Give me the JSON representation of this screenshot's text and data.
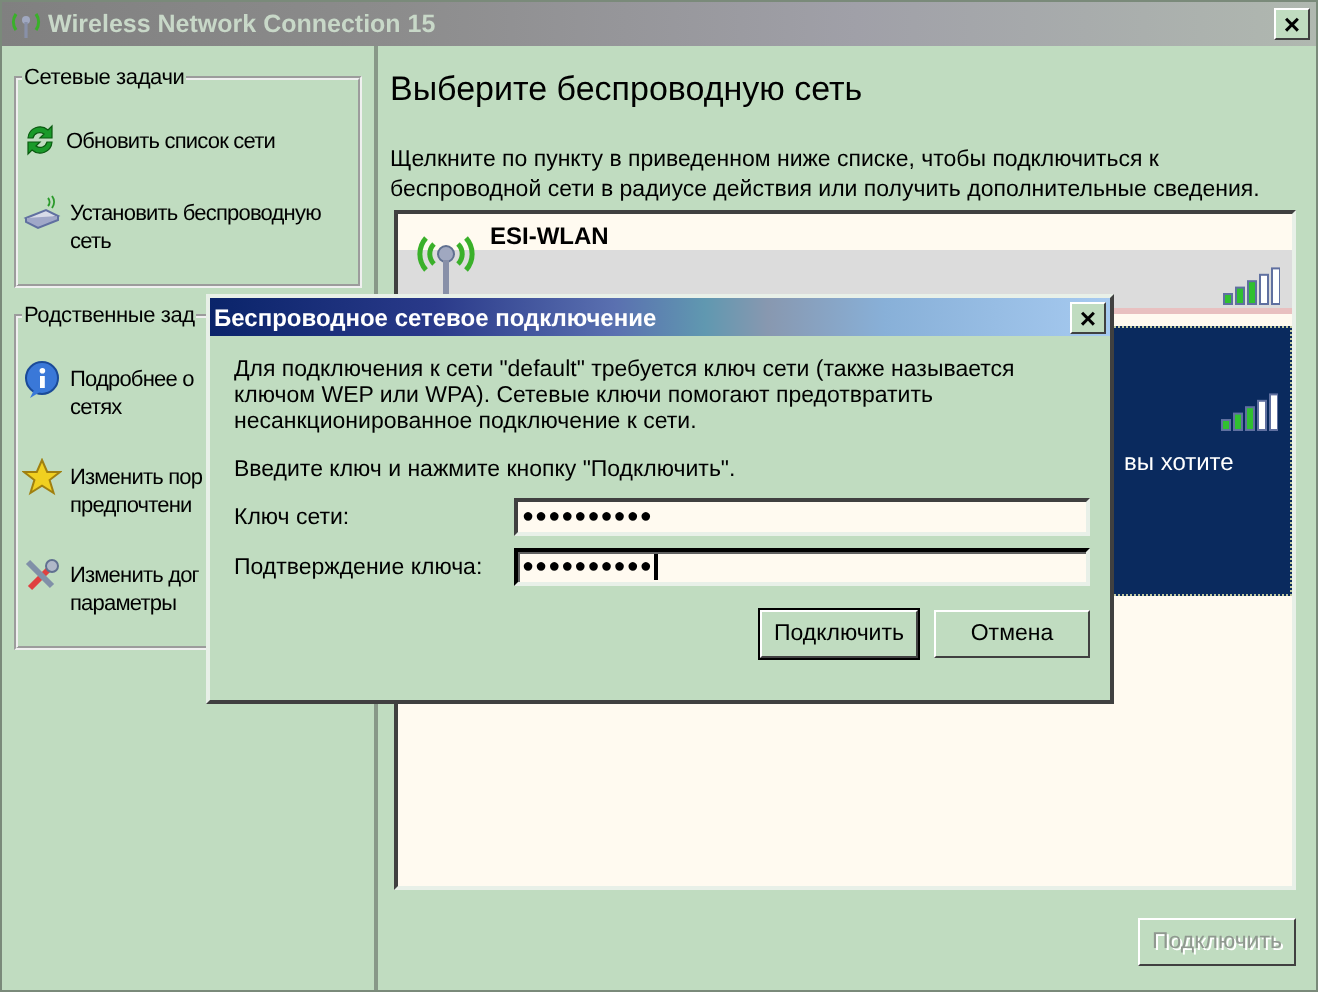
{
  "window": {
    "title": "Wireless Network Connection 15",
    "close": "×"
  },
  "sidebar": {
    "groups": [
      {
        "title": "Сетевые задачи",
        "items": [
          {
            "kind": "refresh",
            "lines": [
              "Обновить список сети"
            ]
          },
          {
            "kind": "setup",
            "lines": [
              "Установить беспроводную",
              "сеть"
            ]
          }
        ]
      },
      {
        "title": "Родственные зад",
        "items": [
          {
            "kind": "info",
            "lines": [
              "Подробнее о",
              "сетях"
            ]
          },
          {
            "kind": "star",
            "lines": [
              "Изменить пор",
              "предпочтени"
            ]
          },
          {
            "kind": "tools",
            "lines": [
              "Изменить дог",
              "параметры"
            ]
          }
        ]
      }
    ]
  },
  "main": {
    "heading": "Выберите беспроводную сеть",
    "description": "Щелкните по пункту в приведенном ниже списке, чтобы подключиться к\nбеспроводной сети в радиусе действия или получить дополнительные сведения.",
    "networks": [
      {
        "name": "ESI-WLAN",
        "selected": false
      },
      {
        "note": "вы хотите",
        "selected": true
      }
    ],
    "connect_button": {
      "label": "Подключить",
      "disabled": true
    }
  },
  "dialog": {
    "title": "Беспроводное сетевое подключение",
    "close": "×",
    "message": "Для подключения к сети \"default\" требуется ключ сети (также называется\nключом WEP или WPA). Сетевые ключи помогают предотвратить\nнесанкционированное подключение к сети.",
    "prompt": "Введите ключ и нажмите кнопку \"Подключить\".",
    "fields": [
      {
        "label": "Ключ сети:",
        "value": "●●●●●●●●●●",
        "focused": false
      },
      {
        "label": "Подтверждение ключа:",
        "value": "●●●●●●●●●●",
        "focused": true
      }
    ],
    "buttons": [
      {
        "label": "Подключить",
        "default": true
      },
      {
        "label": "Отмена",
        "default": false
      }
    ]
  }
}
